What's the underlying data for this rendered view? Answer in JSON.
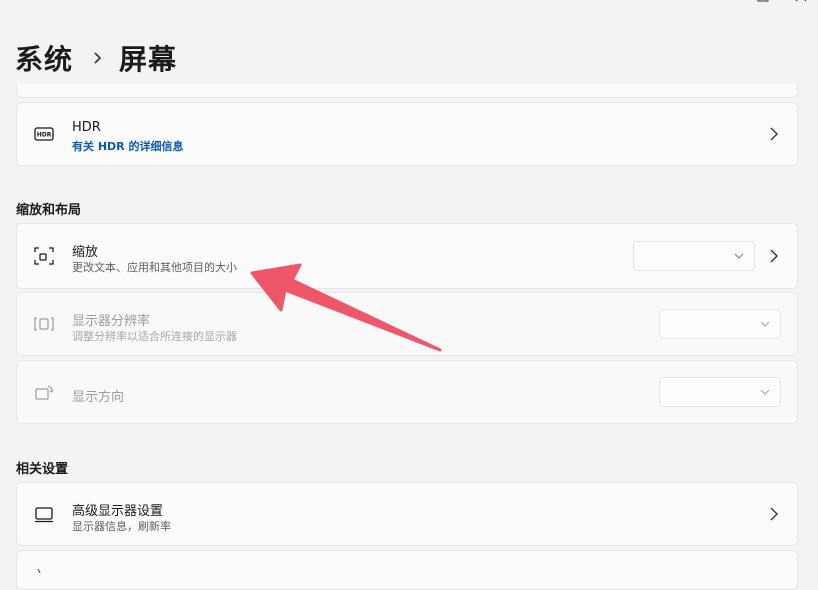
{
  "breadcrumb": {
    "parent": "系统",
    "current": "屏幕"
  },
  "hdr": {
    "title": "HDR",
    "link": "有关 HDR 的详细信息"
  },
  "scale_layout": {
    "heading": "缩放和布局",
    "scale": {
      "title": "缩放",
      "subtitle": "更改文本、应用和其他项目的大小"
    },
    "resolution": {
      "title": "显示器分辨率",
      "subtitle": "调整分辨率以适合所连接的显示器"
    },
    "orientation": {
      "title": "显示方向"
    }
  },
  "related": {
    "heading": "相关设置",
    "advanced_display": {
      "title": "高级显示器设置",
      "subtitle": "显示器信息，刷新率"
    }
  },
  "colors": {
    "accent_link": "#0b5bb3",
    "annotation_arrow": "#f0566a"
  }
}
